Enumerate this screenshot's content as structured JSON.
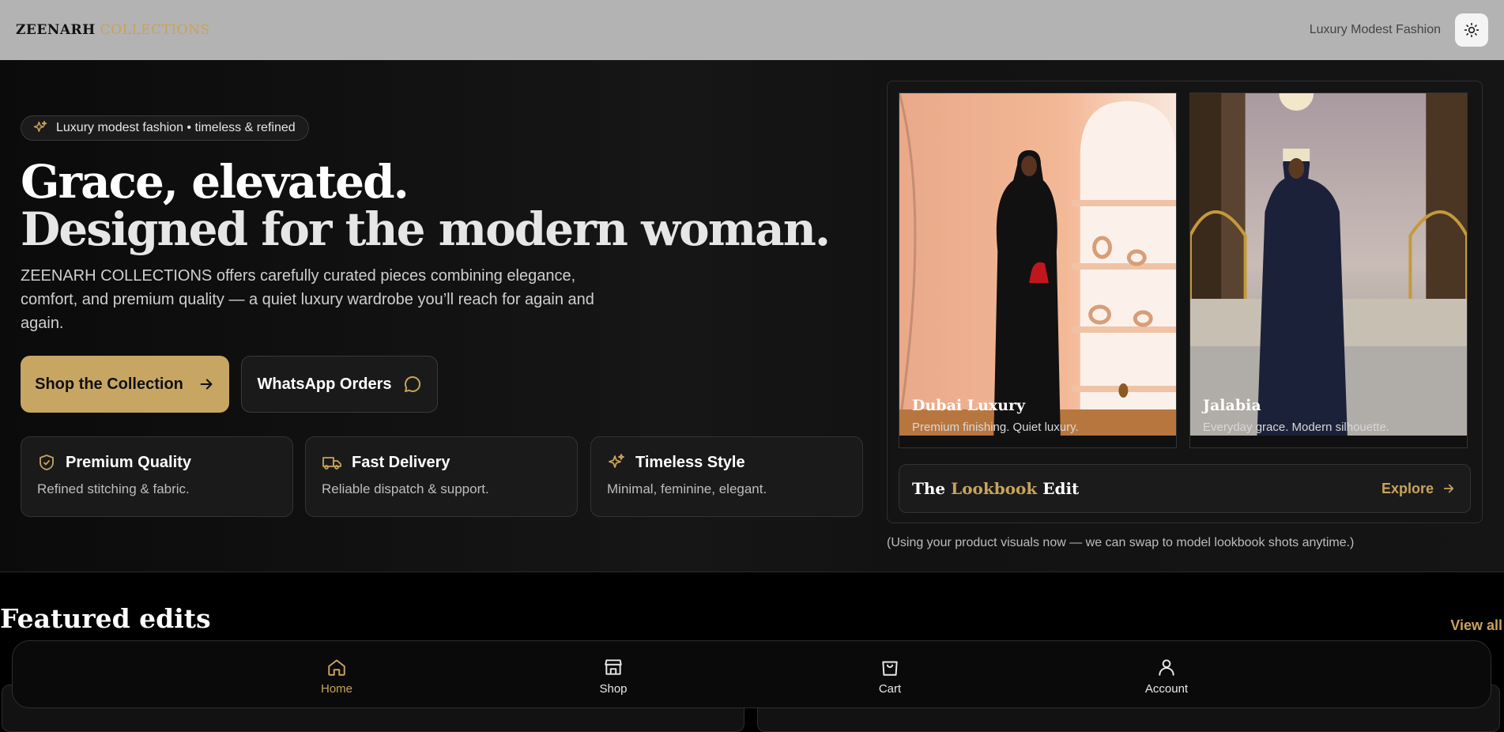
{
  "header": {
    "logo_primary": "ZEENARH",
    "logo_secondary": "COLLECTIONS",
    "tagline": "Luxury Modest Fashion",
    "theme_icon": "sun-icon"
  },
  "hero": {
    "pill_text": "Luxury modest fashion • timeless & refined",
    "headline_line1": "Grace, elevated.",
    "headline_line2": "Designed for the modern woman.",
    "description": "ZEENARH COLLECTIONS offers carefully curated pieces combining elegance, comfort, and premium quality — a quiet luxury wardrobe you’ll reach for again and again.",
    "primary_button": "Shop the Collection",
    "secondary_button": "WhatsApp Orders",
    "features": [
      {
        "icon": "shield-check-icon",
        "title": "Premium Quality",
        "subtitle": "Refined stitching & fabric."
      },
      {
        "icon": "truck-icon",
        "title": "Fast Delivery",
        "subtitle": "Reliable dispatch & support."
      },
      {
        "icon": "sparkles-icon",
        "title": "Timeless Style",
        "subtitle": "Minimal, feminine, elegant."
      }
    ]
  },
  "gallery": {
    "cards": [
      {
        "title": "Dubai Luxury",
        "subtitle": "Premium finishing. Quiet luxury."
      },
      {
        "title": "Jalabia",
        "subtitle": "Everyday grace. Modern silhouette."
      }
    ],
    "lookbook_prefix": "The",
    "lookbook_gold": "Lookbook",
    "lookbook_suffix": "Edit",
    "explore": "Explore",
    "note": "(Using your product visuals now — we can swap to model lookbook shots anytime.)"
  },
  "featured": {
    "title": "Featured edits",
    "view_all": "View all"
  },
  "bottom_nav": {
    "items": [
      {
        "label": "Home",
        "icon": "home-icon",
        "active": true
      },
      {
        "label": "Shop",
        "icon": "store-icon",
        "active": false
      },
      {
        "label": "Cart",
        "icon": "shopping-bag-icon",
        "active": false
      },
      {
        "label": "Account",
        "icon": "user-icon",
        "active": false
      }
    ]
  },
  "colors": {
    "accent_gold": "#c7a663",
    "background": "#000000",
    "header_bg": "#b3b3b3"
  }
}
